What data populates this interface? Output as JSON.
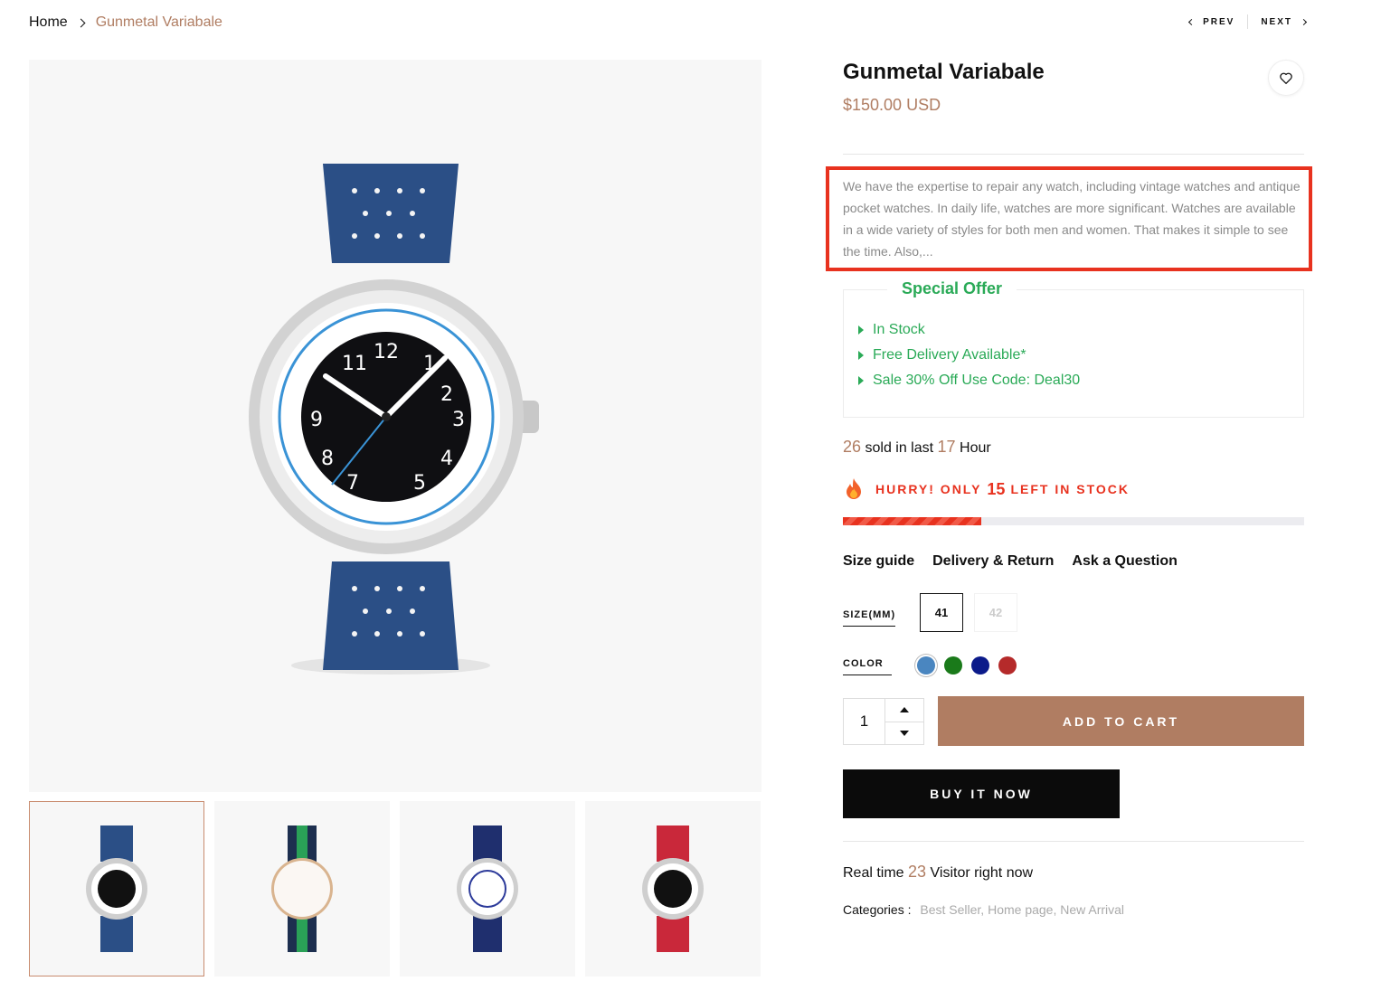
{
  "breadcrumb": {
    "home": "Home",
    "current": "Gunmetal Variabale"
  },
  "pager": {
    "prev": "PREV",
    "next": "NEXT"
  },
  "product": {
    "title": "Gunmetal Variabale",
    "price": "$150.00 USD",
    "description": "We have the expertise to repair any watch, including vintage watches and antique pocket watches. In daily life, watches are more significant. Watches are available in a wide variety of styles for both men and women. That makes it simple to see the time. Also,..."
  },
  "offer": {
    "title": "Special Offer",
    "items": [
      "In Stock",
      "Free Delivery Available*",
      "Sale 30% Off Use Code: Deal30"
    ]
  },
  "sold": {
    "count": "26",
    "text1": "sold in last",
    "hours": "17",
    "text2": "Hour"
  },
  "hurry": {
    "prefix": "HURRY! ONLY",
    "count": "15",
    "suffix": "LEFT IN STOCK",
    "stock_fraction": 0.3
  },
  "tabs": [
    "Size guide",
    "Delivery & Return",
    "Ask a Question"
  ],
  "size": {
    "label": "SIZE(MM)",
    "options": [
      "41",
      "42"
    ],
    "selected": "41"
  },
  "color": {
    "label": "COLOR",
    "swatches": [
      "#4a86c0",
      "#1a7a1a",
      "#0b1a8a",
      "#b52a2a"
    ]
  },
  "quantity": "1",
  "buttons": {
    "add_to_cart": "ADD TO CART",
    "buy_now": "BUY IT NOW"
  },
  "visitors": {
    "prefix": "Real time",
    "count": "23",
    "suffix": "Visitor right now"
  },
  "categories": {
    "label": "Categories :",
    "list": "Best Seller, Home page, New Arrival"
  },
  "colors": {
    "accent": "#b07d62",
    "green": "#2aaa57",
    "red": "#e8321f"
  }
}
